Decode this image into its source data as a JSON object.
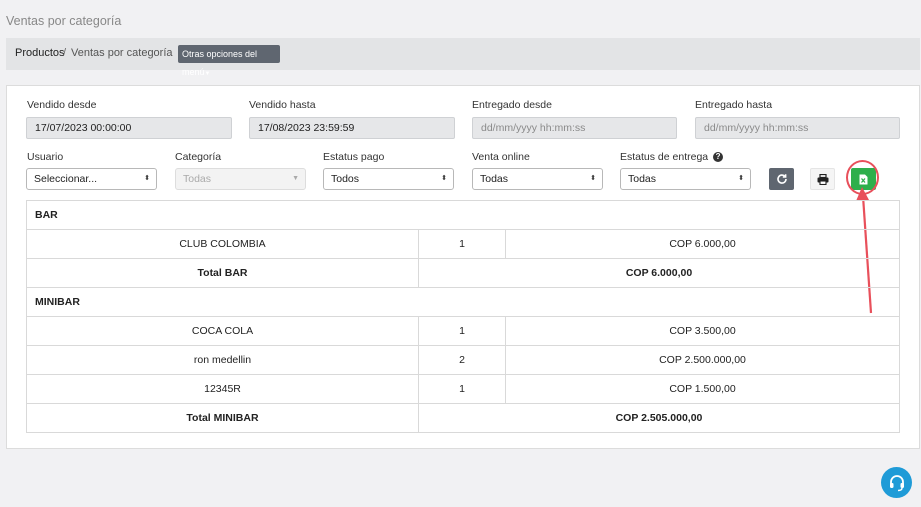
{
  "page": {
    "title": "Ventas por categoría"
  },
  "breadcrumb": {
    "items": [
      "Productos",
      "Ventas por categoría"
    ],
    "separator": "/",
    "menu_button": "Otras opciones del menú"
  },
  "filters": {
    "sold_from": {
      "label": "Vendido desde",
      "value": "17/07/2023 00:00:00"
    },
    "sold_to": {
      "label": "Vendido hasta",
      "value": "17/08/2023 23:59:59"
    },
    "delivered_from": {
      "label": "Entregado desde",
      "placeholder": "dd/mm/yyyy hh:mm:ss"
    },
    "delivered_to": {
      "label": "Entregado hasta",
      "placeholder": "dd/mm/yyyy hh:mm:ss"
    },
    "user": {
      "label": "Usuario",
      "value": "Seleccionar..."
    },
    "category": {
      "label": "Categoría",
      "value": "Todas"
    },
    "payment_status": {
      "label": "Estatus pago",
      "value": "Todos"
    },
    "online_sale": {
      "label": "Venta online",
      "value": "Todas"
    },
    "delivery_status": {
      "label": "Estatus de entrega",
      "value": "Todas"
    }
  },
  "actions": {
    "refresh_icon": "refresh-icon",
    "print_icon": "print-icon",
    "excel_icon": "excel-export-icon",
    "accent": "#2eaf4b",
    "highlight": "#e8505b"
  },
  "report": {
    "groups": [
      {
        "name": "BAR",
        "rows": [
          {
            "product": "CLUB COLOMBIA",
            "qty": "1",
            "amount": "COP 6.000,00"
          }
        ],
        "total_label": "Total BAR",
        "total_amount": "COP 6.000,00"
      },
      {
        "name": "MINIBAR",
        "rows": [
          {
            "product": "COCA COLA",
            "qty": "1",
            "amount": "COP 3.500,00"
          },
          {
            "product": "ron medellin",
            "qty": "2",
            "amount": "COP 2.500.000,00"
          },
          {
            "product": "12345R",
            "qty": "1",
            "amount": "COP 1.500,00"
          }
        ],
        "total_label": "Total MINIBAR",
        "total_amount": "COP 2.505.000,00"
      }
    ]
  },
  "support": {
    "icon": "headset-icon",
    "color": "#1f9bd7"
  }
}
